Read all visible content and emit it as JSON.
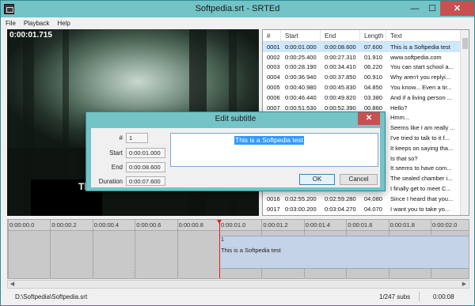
{
  "window": {
    "title": "Softpedia.srt - SRTEd",
    "min": "—",
    "max": "☐",
    "close": "✕"
  },
  "menu": [
    "File",
    "Playback",
    "Help"
  ],
  "video": {
    "time": "0:00:01.715",
    "subtitle_fragment": "This"
  },
  "list": {
    "columns": [
      "#",
      "Start",
      "End",
      "Length",
      "Text"
    ],
    "rows": [
      [
        "0001",
        "0:00:01.000",
        "0:00:08.600",
        "07.600",
        "This is a Softpedia test"
      ],
      [
        "0002",
        "0:00:25.400",
        "0:00:27.310",
        "01.910",
        "www.softpedia.com"
      ],
      [
        "0003",
        "0:00:28.190",
        "0:00:34.410",
        "06.220",
        "You can start school a..."
      ],
      [
        "0004",
        "0:00:36.940",
        "0:00:37.850",
        "00.910",
        "Why aren't you replyi..."
      ],
      [
        "0005",
        "0:00:40.980",
        "0:00:45.830",
        "04.850",
        "You know... Even a tir..."
      ],
      [
        "0006",
        "0:00:46.440",
        "0:00:49.820",
        "03.380",
        "And if a living person ..."
      ],
      [
        "0007",
        "0:00:51.530",
        "0:00:52.390",
        "00.860",
        "Hello?"
      ],
      [
        "",
        "",
        "",
        "",
        "Hmm..."
      ],
      [
        "",
        "",
        "",
        "",
        "Seems like I am really ..."
      ],
      [
        "",
        "",
        "",
        "",
        "I've tried to talk to it f..."
      ],
      [
        "",
        "",
        "",
        "",
        "It keeps on saying tha..."
      ],
      [
        "",
        "",
        "",
        "",
        "Is that so?"
      ],
      [
        "",
        "",
        "",
        "",
        "It seems to have com..."
      ],
      [
        "",
        "",
        "",
        "",
        "The sealed chamber i..."
      ],
      [
        "",
        "",
        "",
        "",
        "I finally get to meet C..."
      ],
      [
        "0016",
        "0:02:55.200",
        "0:02:59.280",
        "04.080",
        "Since I heard that you..."
      ],
      [
        "0017",
        "0:03:00.200",
        "0:03:04.270",
        "04.070",
        "I want you to take yo..."
      ]
    ]
  },
  "timeline": {
    "ticks": [
      "0:00:00.0",
      "0:00:00.2",
      "0:00:00.4",
      "0:00:00.6",
      "0:00:00.8",
      "0:00:01.0",
      "0:00:01.2",
      "0:00:01.4",
      "0:00:01.6",
      "0:00:01.8",
      "0:00:02.0"
    ],
    "block_number": "1",
    "block_text": "This is a Softpedia test"
  },
  "status": {
    "path": "D:\\Softpedia\\Softpedia.srt",
    "count": "1/247 subs",
    "time": "0:00:08"
  },
  "dialog": {
    "title": "Edit subtitle",
    "close": "✕",
    "num_label": "#",
    "num_value": "1",
    "start_label": "Start",
    "start_value": "0:00:01.000",
    "end_label": "End",
    "end_value": "0:00:08.600",
    "duration_label": "Duration",
    "duration_value": "0:00:07.600",
    "text": "This is a Softpedia test",
    "ok": "OK",
    "cancel": "Cancel"
  }
}
